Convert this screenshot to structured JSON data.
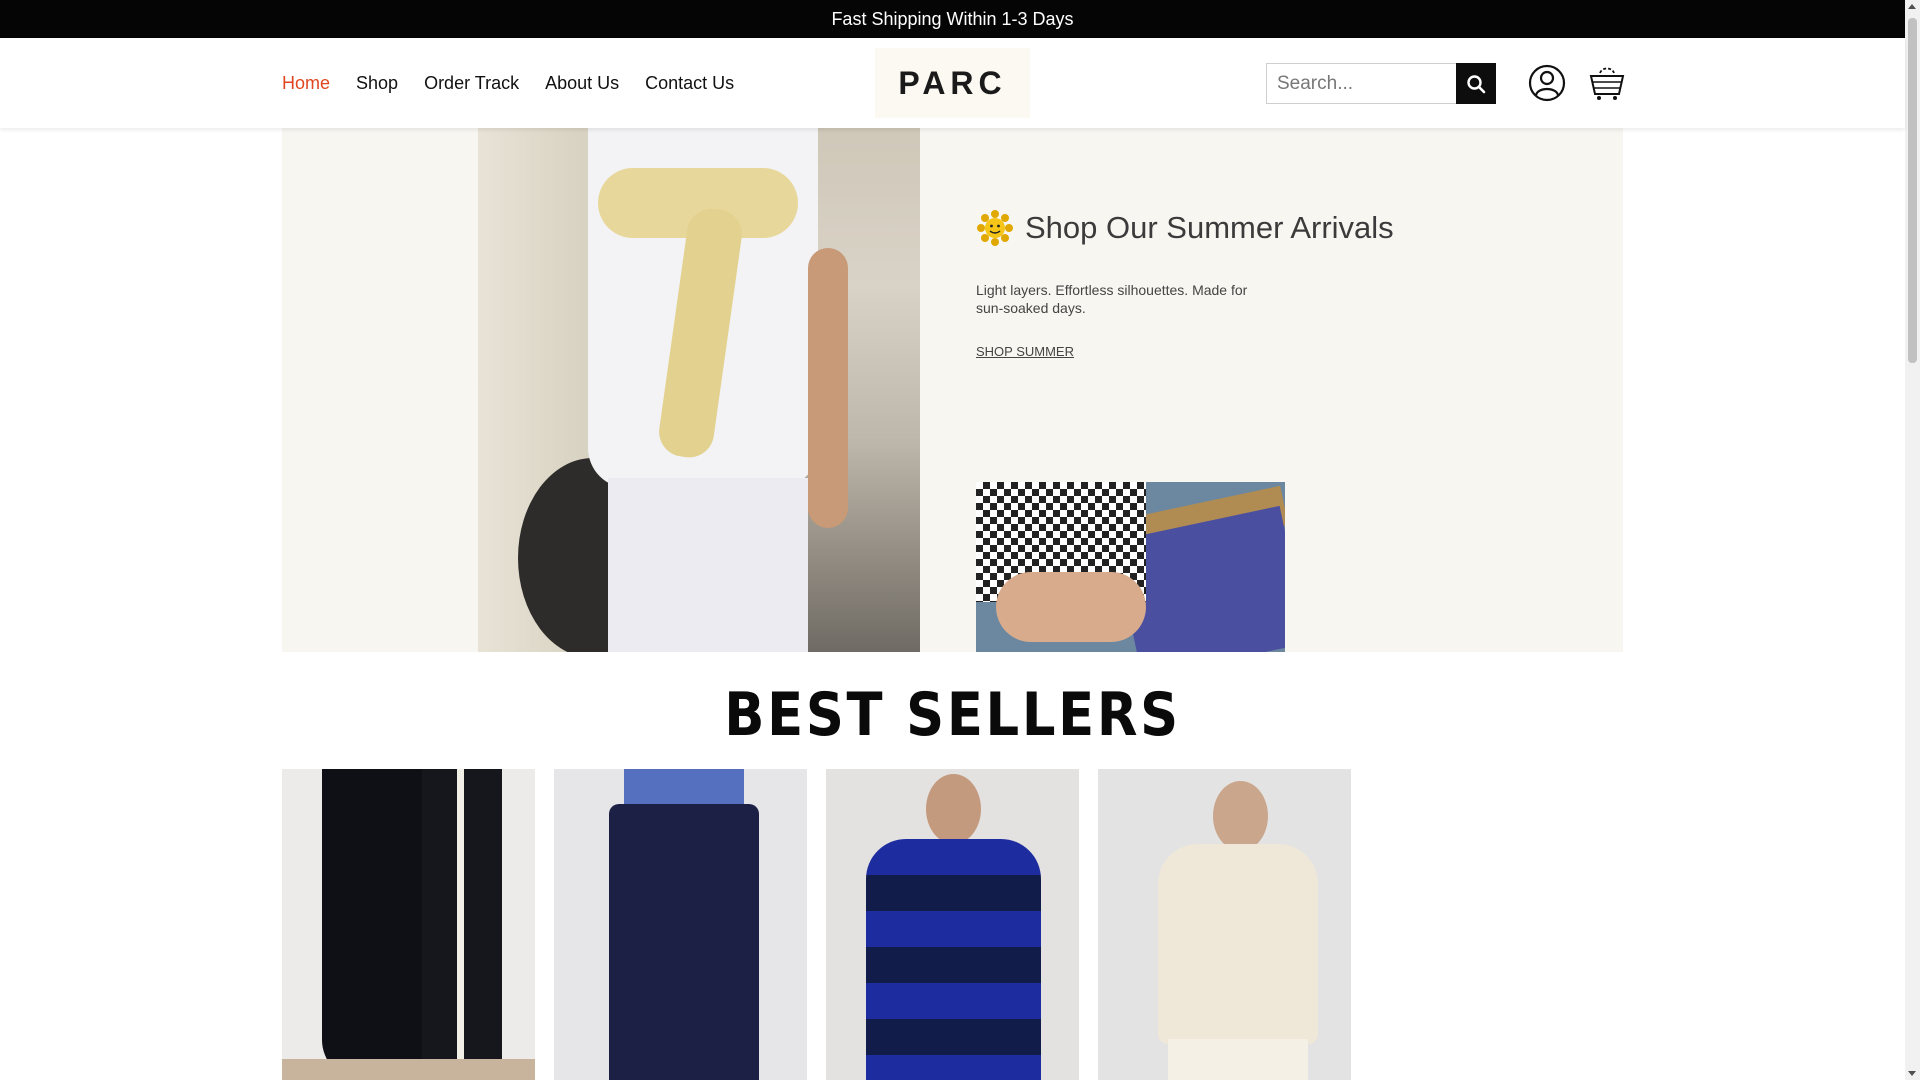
{
  "announcement": "Fast Shipping Within 1-3 Days",
  "nav": {
    "items": [
      {
        "label": "Home",
        "active": true
      },
      {
        "label": "Shop"
      },
      {
        "label": "Order Track"
      },
      {
        "label": "About Us"
      },
      {
        "label": "Contact Us"
      }
    ],
    "active_color": "#e0461f"
  },
  "logo": "PARC",
  "search": {
    "placeholder": "Search...",
    "button_icon": "search-icon"
  },
  "header_icons": [
    "user-account-icon",
    "shopping-cart-icon"
  ],
  "hero": {
    "title": "Shop Our Summer Arrivals",
    "title_icon": "sun-flower-icon",
    "description": "Light layers. Effortless silhouettes. Made for sun-soaked days.",
    "link": "SHOP SUMMER"
  },
  "best_sellers": {
    "title": "BEST SELLERS",
    "products": [
      {
        "image": "black satin pants with white side stripe"
      },
      {
        "image": "navy wide-leg pants"
      },
      {
        "image": "blue striped sweater"
      },
      {
        "image": "cream knit sweater"
      }
    ]
  }
}
